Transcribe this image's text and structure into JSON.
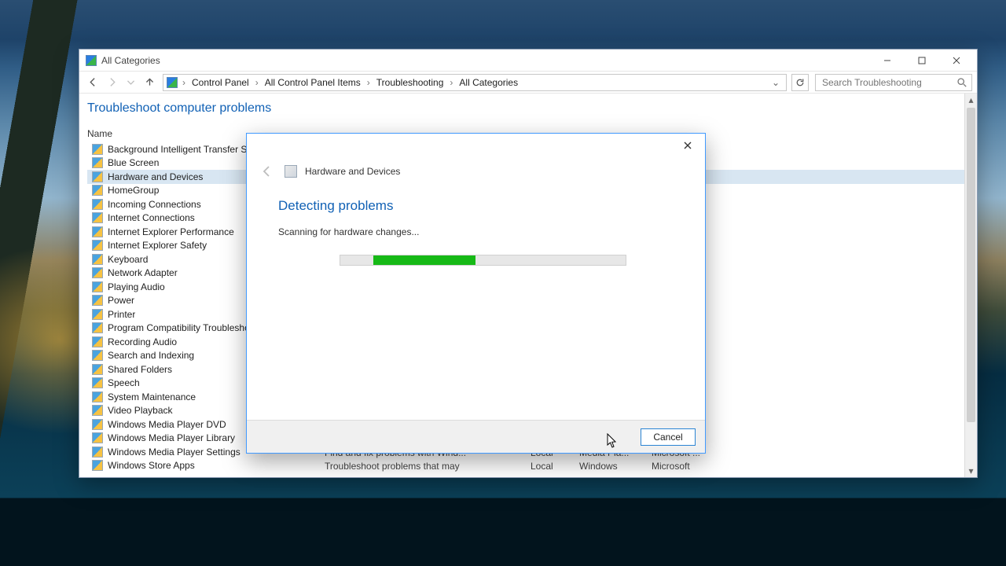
{
  "window": {
    "title": "All Categories",
    "search_placeholder": "Search Troubleshooting"
  },
  "breadcrumbs": [
    "Control Panel",
    "All Control Panel Items",
    "Troubleshooting",
    "All Categories"
  ],
  "page_heading": "Troubleshoot computer problems",
  "column_header": "Name",
  "items": [
    "Background Intelligent Transfer Se",
    "Blue Screen",
    "Hardware and Devices",
    "HomeGroup",
    "Incoming Connections",
    "Internet Connections",
    "Internet Explorer Performance",
    "Internet Explorer Safety",
    "Keyboard",
    "Network Adapter",
    "Playing Audio",
    "Power",
    "Printer",
    "Program Compatibility Troublesho",
    "Recording Audio",
    "Search and Indexing",
    "Shared Folders",
    "Speech",
    "System Maintenance",
    "Video Playback",
    "Windows Media Player DVD",
    "Windows Media Player Library",
    "Windows Media Player Settings",
    "Windows Store Apps"
  ],
  "selected_index": 2,
  "bottom_rows": [
    [
      "Find and fix problems with Wind...",
      "Local",
      "Media Pla...",
      "Microsoft ..."
    ],
    [
      "Troubleshoot problems that may",
      "Local",
      "Windows",
      "Microsoft"
    ]
  ],
  "dialog": {
    "title": "Hardware and Devices",
    "heading": "Detecting problems",
    "message": "Scanning for hardware changes...",
    "cancel": "Cancel"
  }
}
